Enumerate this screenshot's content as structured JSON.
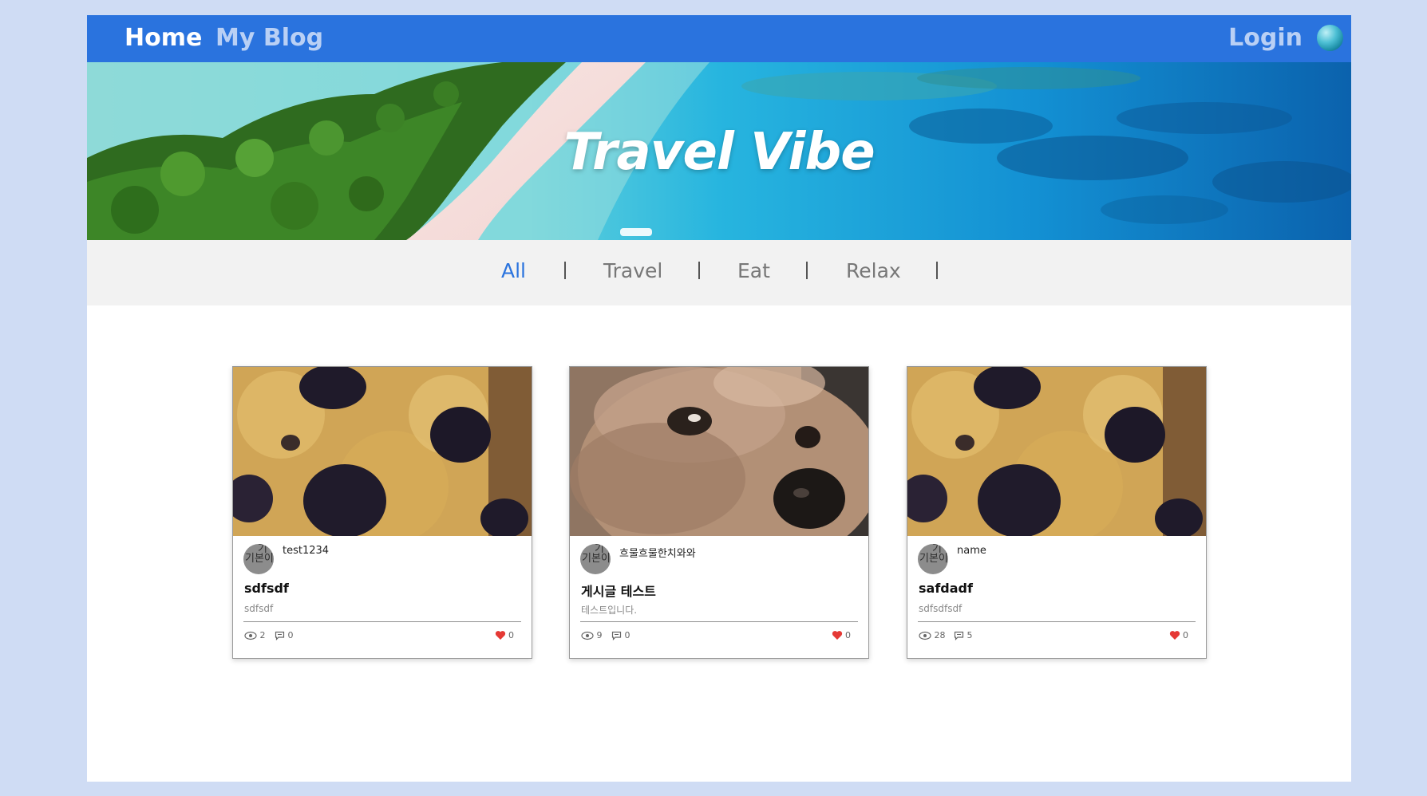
{
  "nav": {
    "home": "Home",
    "my_blog": "My Blog",
    "login": "Login"
  },
  "hero": {
    "title": "Travel Vibe"
  },
  "categories": [
    "All",
    "Travel",
    "Eat",
    "Relax"
  ],
  "active_category": "All",
  "colors": {
    "nav_bg": "#2a73de",
    "accent": "#2a73de",
    "page_bg": "#cfdcf4",
    "category_bar_bg": "#f2f2f2",
    "like_heart": "#e53935"
  },
  "avatar_text": "기본이",
  "posts": [
    {
      "author": "test1234",
      "title": "sdfsdf",
      "excerpt": "sdfsdf",
      "views": "2",
      "comments": "0",
      "likes": "0",
      "image": "blueberry-muffin"
    },
    {
      "author": "흐물흐물한치와와",
      "title": "게시글 테스트",
      "excerpt": "테스트입니다.",
      "views": "9",
      "comments": "0",
      "likes": "0",
      "image": "crying-dog"
    },
    {
      "author": "name",
      "title": "safdadf",
      "excerpt": "sdfsdfsdf",
      "views": "28",
      "comments": "5",
      "likes": "0",
      "image": "blueberry-muffin"
    }
  ]
}
